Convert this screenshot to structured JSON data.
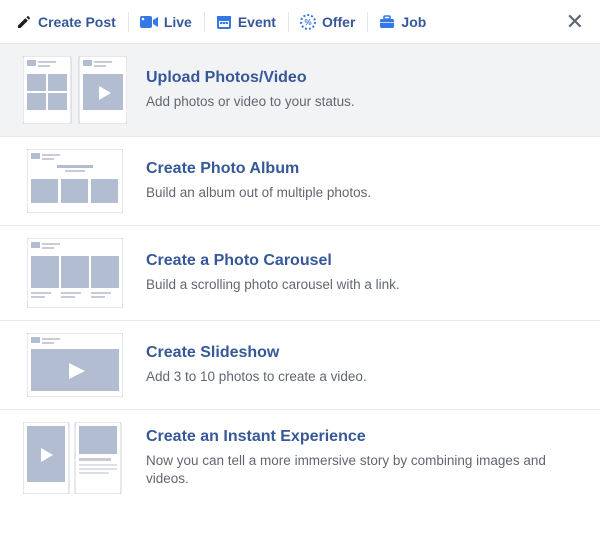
{
  "colors": {
    "link": "#365899",
    "accent": "#3578e5",
    "muted": "#616770",
    "fill": "#b2bdd2",
    "stroke": "#ccd0d5",
    "selected_bg": "#f2f3f5"
  },
  "tabs": [
    {
      "id": "create-post",
      "label": "Create Post",
      "icon": "pencil-icon",
      "active": true
    },
    {
      "id": "live",
      "label": "Live",
      "icon": "camera-icon",
      "active": false
    },
    {
      "id": "event",
      "label": "Event",
      "icon": "calendar-icon",
      "active": false
    },
    {
      "id": "offer",
      "label": "Offer",
      "icon": "offer-icon",
      "active": false
    },
    {
      "id": "job",
      "label": "Job",
      "icon": "briefcase-icon",
      "active": false
    }
  ],
  "close_label": "Close",
  "options": [
    {
      "id": "upload",
      "title": "Upload Photos/Video",
      "desc": "Add photos or video to your status.",
      "selected": true
    },
    {
      "id": "album",
      "title": "Create Photo Album",
      "desc": "Build an album out of multiple photos.",
      "selected": false
    },
    {
      "id": "carousel",
      "title": "Create a Photo Carousel",
      "desc": "Build a scrolling photo carousel with a link.",
      "selected": false
    },
    {
      "id": "slideshow",
      "title": "Create Slideshow",
      "desc": "Add 3 to 10 photos to create a video.",
      "selected": false
    },
    {
      "id": "instant",
      "title": "Create an Instant Experience",
      "desc": "Now you can tell a more immersive story by combining images and videos.",
      "selected": false
    }
  ]
}
